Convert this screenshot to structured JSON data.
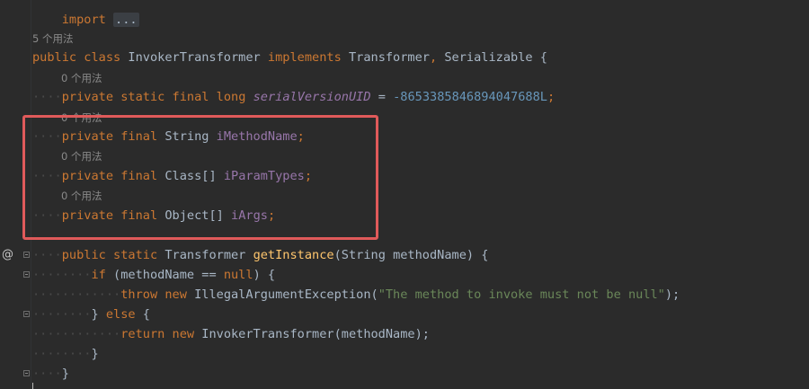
{
  "editor": {
    "import_line": {
      "keyword": "import",
      "ellipsis": "..."
    },
    "usage_hints": {
      "class_usages": "5 个用法",
      "serial_usages": "0 个用法",
      "method_name_usages": "0 个用法",
      "param_types_usages": "0 个用法",
      "args_usages": "0 个用法"
    },
    "class_decl": {
      "kw_public": "public",
      "kw_class": "class",
      "name": "InvokerTransformer",
      "kw_implements": "implements",
      "iface1": "Transformer",
      "comma": ",",
      "iface2": "Serializable",
      "brace": "{"
    },
    "serial_line": {
      "kw_private": "private",
      "kw_static": "static",
      "kw_final": "final",
      "kw_long": "long",
      "field": "serialVersionUID",
      "op": "=",
      "value": "-8653385846894047688L",
      "semi": ";"
    },
    "method_name_line": {
      "kw_private": "private",
      "kw_final": "final",
      "type": "String",
      "field": "iMethodName",
      "semi": ";"
    },
    "param_types_line": {
      "kw_private": "private",
      "kw_final": "final",
      "type": "Class[]",
      "field": "iParamTypes",
      "semi": ";"
    },
    "args_line": {
      "kw_private": "private",
      "kw_final": "final",
      "type": "Object[]",
      "field": "iArgs",
      "semi": ";"
    },
    "get_instance_line": {
      "kw_public": "public",
      "kw_static": "static",
      "ret_type": "Transformer",
      "method": "getInstance",
      "params": "(String methodName)",
      "brace": "{"
    },
    "if_line": {
      "kw_if": "if",
      "open": "(methodName ==",
      "kw_null": "null",
      "close": ") {"
    },
    "throw_line": {
      "kw_throw": "throw",
      "kw_new": "new",
      "exception": "IllegalArgumentException(",
      "message": "\"The method to invoke must not be null\"",
      "close": ");"
    },
    "else_line": {
      "open": "}",
      "kw_else": "else",
      "brace": "{"
    },
    "return_line": {
      "kw_return": "return",
      "kw_new": "new",
      "call": "InvokerTransformer(methodName);"
    },
    "close_inner": "}",
    "close_method": "}",
    "gutter_marker": "@",
    "indent_dots": {
      "one": "····",
      "two": "········",
      "three": "············"
    }
  },
  "colors": {
    "background": "#2b2b2b",
    "keyword": "#cc7832",
    "field": "#9876aa",
    "number": "#6897bb",
    "string": "#6a8759",
    "method": "#ffc66d",
    "highlight_border": "#e05a5a"
  }
}
